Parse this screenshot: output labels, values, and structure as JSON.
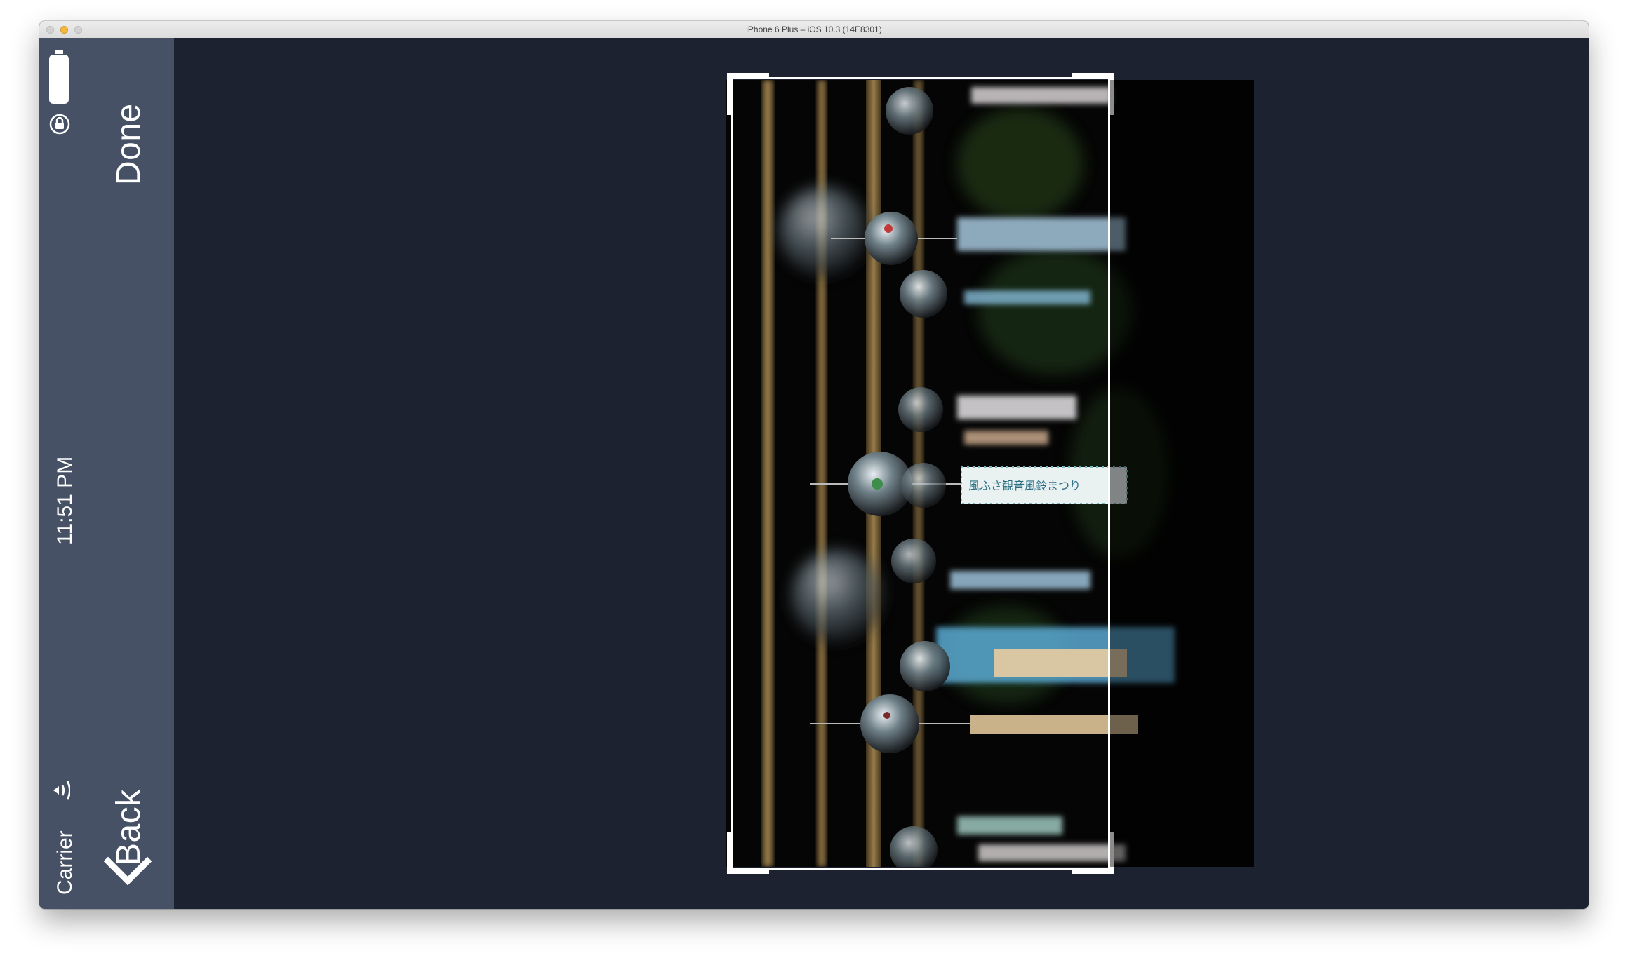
{
  "window": {
    "title": "iPhone 6 Plus – iOS 10.3 (14E8301)"
  },
  "status_bar": {
    "carrier": "Carrier",
    "time": "11:51 PM",
    "icons": [
      "wifi-icon",
      "orientation-lock-icon",
      "battery-icon"
    ]
  },
  "nav": {
    "back_label": "Back",
    "back_icon": "chevron-left-icon",
    "done_label": "Done"
  },
  "colors": {
    "background": "#1c2230",
    "sidebar": "#465165",
    "crop_frame": "#ffffff"
  },
  "photo": {
    "subject": "glass wind chimes",
    "tag_text": "風ふさ観音風鈴まつり"
  }
}
